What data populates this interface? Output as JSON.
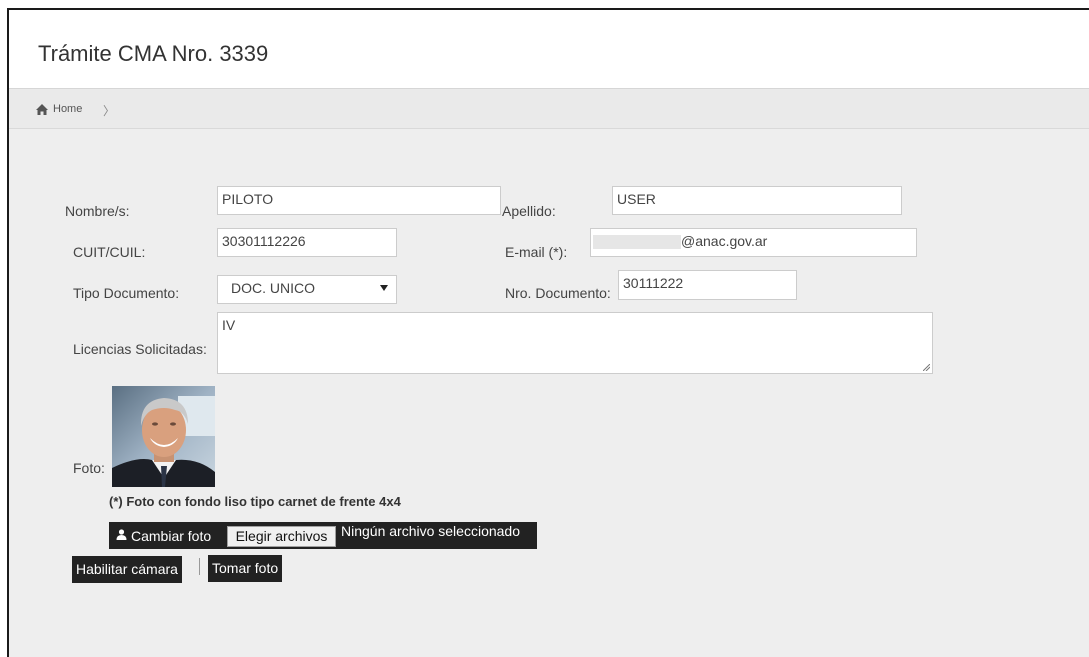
{
  "header": {
    "title": "Trámite CMA Nro. 3339"
  },
  "breadcrumb": {
    "home_label": "Home",
    "separator": "〉"
  },
  "form": {
    "nombre_label": "Nombre/s:",
    "nombre_value": "PILOTO",
    "apellido_label": "Apellido:",
    "apellido_value": "USER",
    "cuit_label": "CUIT/CUIL:",
    "cuit_value": "30301112226",
    "email_label": "E-mail (*):",
    "email_value": "@anac.gov.ar",
    "tipo_doc_label": "Tipo Documento:",
    "tipo_doc_value": "DOC. UNICO",
    "nro_doc_label": "Nro. Documento:",
    "nro_doc_value": "30111222",
    "licencias_label": "Licencias Solicitadas:",
    "licencias_value": "IV",
    "foto_label": "Foto:",
    "foto_note": "(*) Foto con fondo liso tipo carnet de frente 4x4"
  },
  "photo_controls": {
    "cambiar_label": "Cambiar foto",
    "elegir_label": "Elegir archivos",
    "no_file_text": "Ningún archivo seleccionado",
    "habilitar_label": "Habilitar cámara",
    "tomar_label": "Tomar foto"
  },
  "colors": {
    "accent": "#1f74c6",
    "button_dark": "#222222",
    "background": "#eeeeee"
  },
  "icons": {
    "home": "home-icon",
    "user": "user-icon",
    "select_arrow": "caret-down-icon"
  }
}
